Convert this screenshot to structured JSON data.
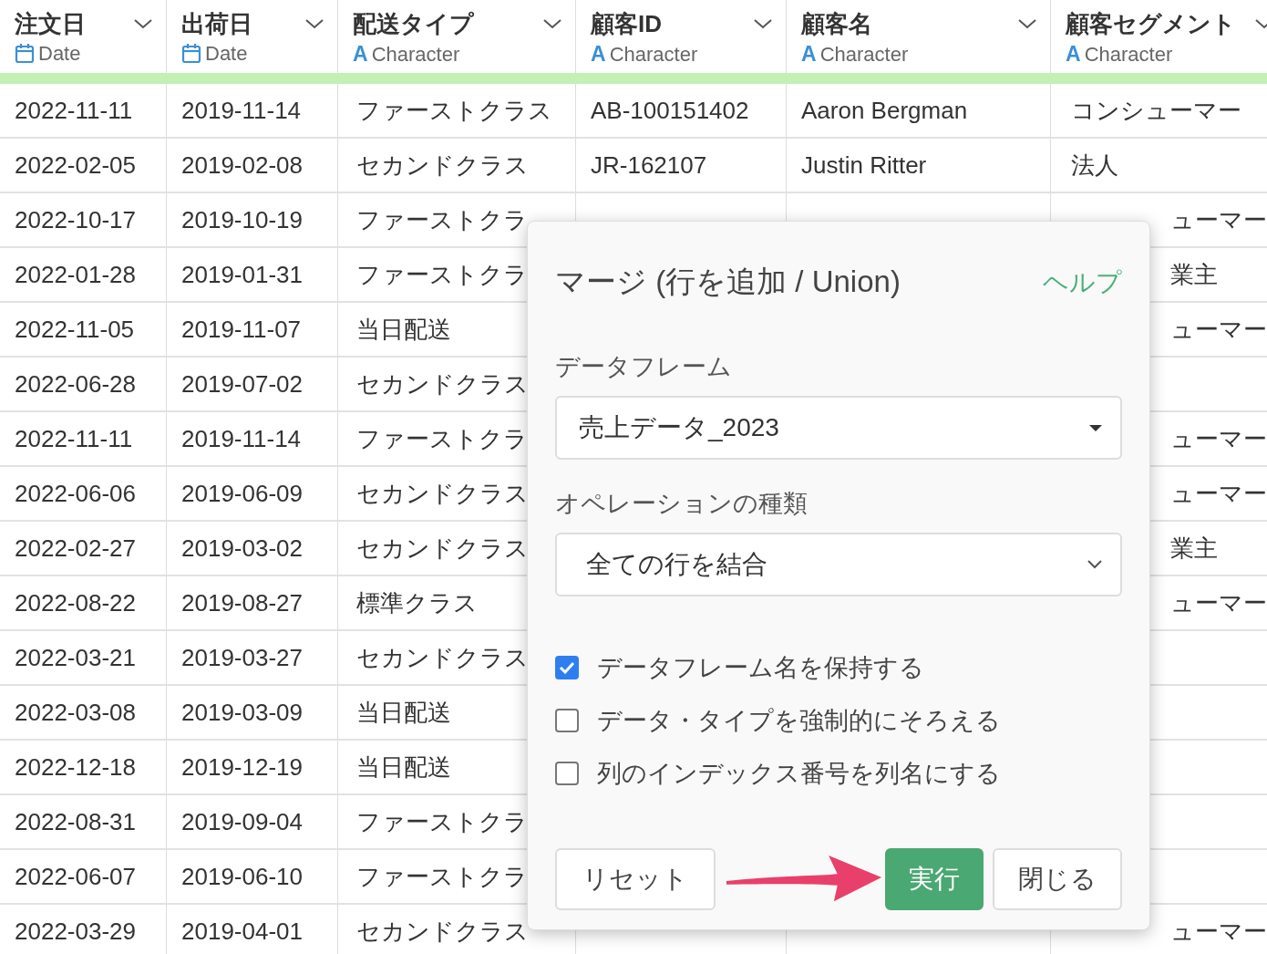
{
  "table": {
    "columns": [
      {
        "name": "注文日",
        "type": "Date",
        "kind": "date"
      },
      {
        "name": "出荷日",
        "type": "Date",
        "kind": "date"
      },
      {
        "name": "配送タイプ",
        "type": "Character",
        "kind": "character",
        "type_mark": "A"
      },
      {
        "name": "顧客ID",
        "type": "Character",
        "kind": "character",
        "type_mark": "A"
      },
      {
        "name": "顧客名",
        "type": "Character",
        "kind": "character",
        "type_mark": "A"
      },
      {
        "name": "顧客セグメント",
        "type": "Character",
        "kind": "character",
        "type_mark": "A"
      }
    ],
    "rows": [
      {
        "cells": [
          "2022-11-11",
          "2019-11-14",
          "ファーストクラス",
          "AB-100151402",
          "Aaron Bergman",
          "コンシューマー"
        ]
      },
      {
        "cells": [
          "2022-02-05",
          "2019-02-08",
          "セカンドクラス",
          "JR-162107",
          "Justin Ritter",
          "法人"
        ]
      },
      {
        "cells": [
          "2022-10-17",
          "2019-10-19",
          "ファーストクラ",
          null,
          null,
          "ューマー"
        ],
        "cut": true
      },
      {
        "cells": [
          "2022-01-28",
          "2019-01-31",
          "ファーストクラ",
          null,
          null,
          "業主"
        ],
        "cut": true
      },
      {
        "cells": [
          "2022-11-05",
          "2019-11-07",
          "当日配送",
          null,
          null,
          "ューマー"
        ],
        "cut": true
      },
      {
        "cells": [
          "2022-06-28",
          "2019-07-02",
          "セカンドクラス",
          null,
          null,
          null
        ]
      },
      {
        "cells": [
          "2022-11-11",
          "2019-11-14",
          "ファーストクラ",
          null,
          null,
          "ューマー"
        ],
        "cut": true
      },
      {
        "cells": [
          "2022-06-06",
          "2019-06-09",
          "セカンドクラス",
          null,
          null,
          "ューマー"
        ],
        "cut": true
      },
      {
        "cells": [
          "2022-02-27",
          "2019-03-02",
          "セカンドクラス",
          null,
          null,
          "業主"
        ],
        "cut": true
      },
      {
        "cells": [
          "2022-08-22",
          "2019-08-27",
          "標準クラス",
          null,
          null,
          "ューマー"
        ],
        "cut": true
      },
      {
        "cells": [
          "2022-03-21",
          "2019-03-27",
          "セカンドクラス",
          null,
          null,
          null
        ]
      },
      {
        "cells": [
          "2022-03-08",
          "2019-03-09",
          "当日配送",
          null,
          null,
          null
        ]
      },
      {
        "cells": [
          "2022-12-18",
          "2019-12-19",
          "当日配送",
          null,
          null,
          null
        ]
      },
      {
        "cells": [
          "2022-08-31",
          "2019-09-04",
          "ファーストクラ",
          null,
          null,
          null
        ]
      },
      {
        "cells": [
          "2022-06-07",
          "2019-06-10",
          "ファーストクラ",
          null,
          null,
          null
        ]
      },
      {
        "cells": [
          "2022-03-29",
          "2019-04-01",
          "セカンドクラス",
          null,
          null,
          "ューマー"
        ],
        "cut": true
      }
    ]
  },
  "dialog": {
    "title": "マージ (行を追加 / Union)",
    "help": "ヘルプ",
    "fields": [
      {
        "label": "データフレーム",
        "value": "売上データ_2023",
        "kind": "dropdown"
      },
      {
        "label": "オペレーションの種類",
        "value": "全ての行を結合",
        "kind": "select"
      }
    ],
    "options": [
      {
        "label": "データフレーム名を保持する",
        "checked": true
      },
      {
        "label": "データ・タイプを強制的にそろえる",
        "checked": false
      },
      {
        "label": "列のインデックス番号を列名にする",
        "checked": false
      }
    ],
    "buttons": [
      {
        "label": "リセット",
        "kind": "default"
      },
      {
        "label": "実行",
        "kind": "primary"
      },
      {
        "label": "閉じる",
        "kind": "default"
      }
    ]
  }
}
